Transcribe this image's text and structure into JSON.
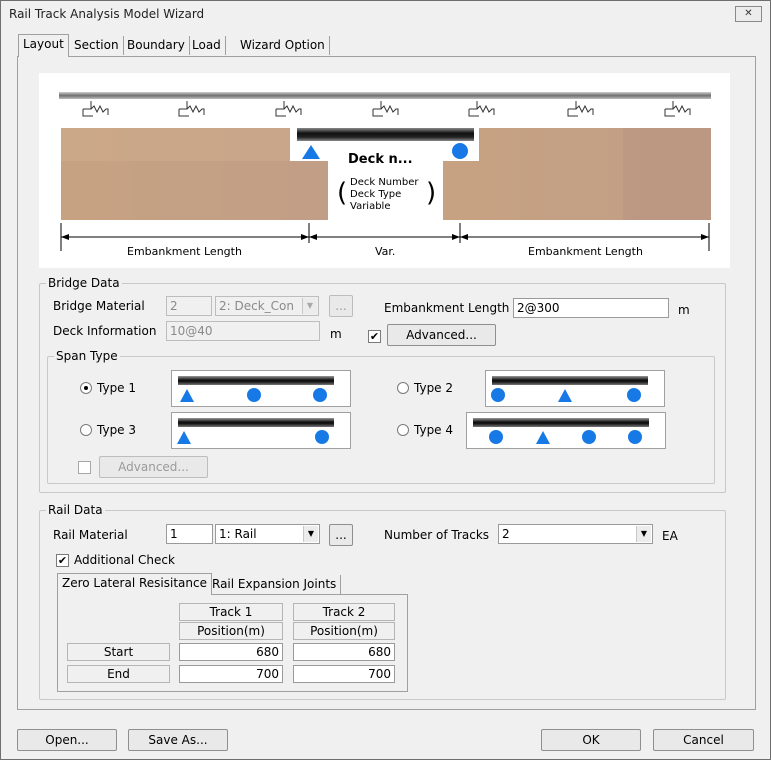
{
  "window": {
    "title": "Rail Track Analysis Model Wizard",
    "close_label": "✕"
  },
  "tabs": [
    "Layout",
    "Section",
    "Boundary",
    "Load",
    "Wizard Option"
  ],
  "diagram": {
    "deck_label": "Deck n...",
    "deck_note_lines": [
      "Deck Number",
      "Deck Type",
      "Variable"
    ],
    "dim_left": "Embankment Length",
    "dim_mid": "Var.",
    "dim_right": "Embankment Length",
    "colors": {
      "support": "#1679e6",
      "embankment": "#c8a484"
    }
  },
  "bridge_data": {
    "group_label": "Bridge Data",
    "material_label": "Bridge Material",
    "material_id": "2",
    "material_combo": "2: Deck_Con",
    "browse_label": "...",
    "embankment_label": "Embankment Length",
    "embankment_value": "2@300",
    "embankment_unit": "m",
    "deck_info_label": "Deck Information",
    "deck_info_value": "10@40",
    "deck_info_unit": "m",
    "advanced_label": "Advanced...",
    "advanced_checked": "✔"
  },
  "span_type": {
    "group_label": "Span Type",
    "types": [
      "Type 1",
      "Type 2",
      "Type 3",
      "Type 4"
    ],
    "advanced_label": "Advanced..."
  },
  "rail_data": {
    "group_label": "Rail Data",
    "material_label": "Rail Material",
    "material_id": "1",
    "material_combo": "1: Rail",
    "browse_label": "...",
    "tracks_label": "Number of Tracks",
    "tracks_value": "2",
    "tracks_unit": "EA",
    "additional_check_label": "Additional Check",
    "additional_checked": "✔",
    "subtabs": [
      "Zero Lateral Resisitance",
      "Rail Expansion Joints"
    ],
    "table": {
      "headers": [
        "Track 1",
        "Track 2"
      ],
      "subheaders": [
        "Position(m)",
        "Position(m)"
      ],
      "rows": [
        {
          "label": "Start",
          "values": [
            "680",
            "680"
          ]
        },
        {
          "label": "End",
          "values": [
            "700",
            "700"
          ]
        }
      ]
    }
  },
  "footer": {
    "open": "Open...",
    "save_as": "Save As...",
    "ok": "OK",
    "cancel": "Cancel"
  }
}
